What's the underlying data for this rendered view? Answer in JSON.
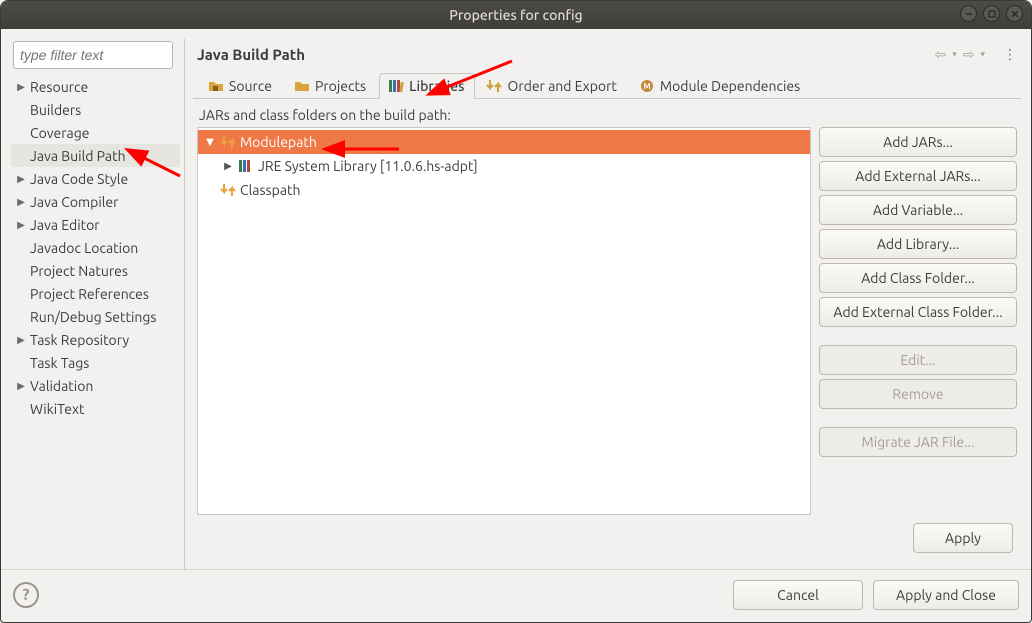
{
  "window": {
    "title": "Properties for config"
  },
  "filter": {
    "placeholder": "type filter text"
  },
  "navtree": {
    "resource": "Resource",
    "builders": "Builders",
    "coverage": "Coverage",
    "jbp": "Java Build Path",
    "jcs": "Java Code Style",
    "jcomp": "Java Compiler",
    "jed": "Java Editor",
    "javadoc": "Javadoc Location",
    "pnat": "Project Natures",
    "pref": "Project References",
    "rds": "Run/Debug Settings",
    "trepo": "Task Repository",
    "ttags": "Task Tags",
    "valid": "Validation",
    "wiki": "WikiText"
  },
  "page": {
    "title": "Java Build Path"
  },
  "tabs": {
    "source": "Source",
    "projects": "Projects",
    "libraries": "Libraries",
    "order": "Order and Export",
    "moddeps": "Module Dependencies"
  },
  "libraries": {
    "hint": "JARs and class folders on the build path:",
    "modulepath": "Modulepath",
    "jre": "JRE System Library [11.0.6.hs-adpt]",
    "classpath": "Classpath"
  },
  "buttons": {
    "addjars": "Add JARs...",
    "addext": "Add External JARs...",
    "addvar": "Add Variable...",
    "addlib": "Add Library...",
    "addcf": "Add Class Folder...",
    "addextcf": "Add External Class Folder...",
    "edit": "Edit...",
    "remove": "Remove",
    "migrate": "Migrate JAR File...",
    "apply": "Apply",
    "cancel": "Cancel",
    "applyclose": "Apply and Close"
  }
}
